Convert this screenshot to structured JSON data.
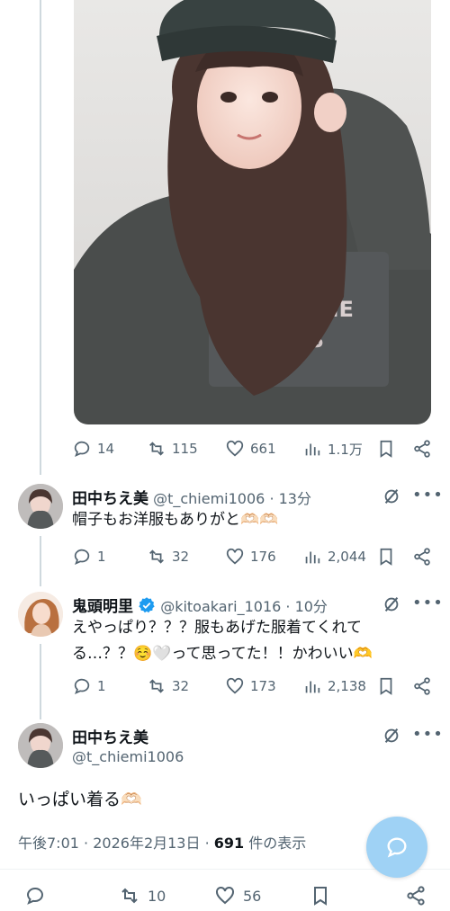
{
  "main_tweet": {
    "actions": {
      "replies": "14",
      "retweets": "115",
      "likes": "661",
      "views": "1.1万"
    }
  },
  "replies": [
    {
      "name": "田中ちえ美",
      "handle": "@t_chiemi1006",
      "time": "· 13分",
      "text": "帽子もお洋服もありがと🫶🏻🫶🏻",
      "actions": {
        "replies": "1",
        "retweets": "32",
        "likes": "176",
        "views": "2,044"
      }
    },
    {
      "name": "鬼頭明里",
      "handle": "@kitoakari_1016",
      "time": "· 10分",
      "text_line1": "えやっぱり？？？服もあげた服着てくれて",
      "text_line2": "る…？？☺️🤍って思ってた！！かわいい🫶",
      "actions": {
        "replies": "1",
        "retweets": "32",
        "likes": "173",
        "views": "2,138"
      }
    }
  ],
  "focused_tweet": {
    "name": "田中ちえ美",
    "handle": "@t_chiemi1006",
    "text": "いっぱい着る🫶🏻",
    "time": "午後7:01",
    "date": "2026年2月13日",
    "views_count": "691",
    "views_label": "件の表示",
    "actions": {
      "retweets": "10",
      "likes": "56"
    }
  },
  "colors": {
    "accent": "#1d9bf0",
    "fab": "#9fd2f5",
    "muted": "#536471",
    "divider": "#eff3f4"
  }
}
